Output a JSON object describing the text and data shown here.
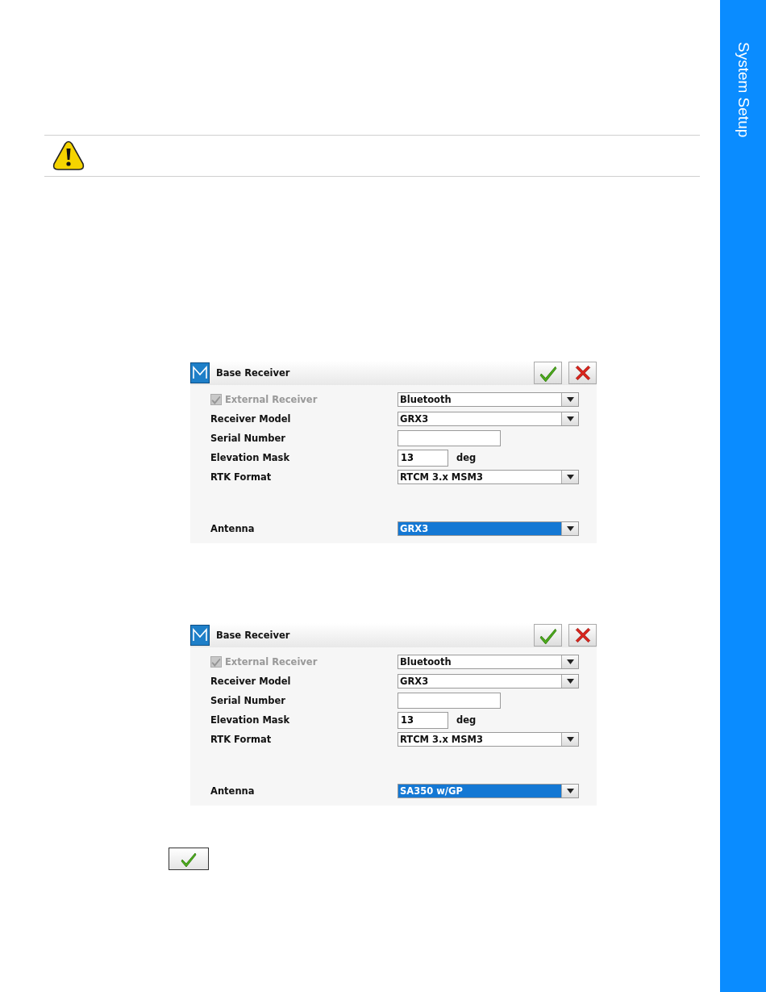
{
  "sidebar": {
    "title": "System Setup"
  },
  "dialogs": [
    {
      "title": "Base Receiver",
      "rows": [
        {
          "kind": "checkbox",
          "label": "External Receiver",
          "checked": true,
          "disabled": true,
          "control": {
            "kind": "dropdown",
            "value": "Bluetooth",
            "highlighted": false
          }
        },
        {
          "kind": "label",
          "label": "Receiver Model",
          "control": {
            "kind": "dropdown",
            "value": "GRX3",
            "highlighted": false
          }
        },
        {
          "kind": "label",
          "label": "Serial Number",
          "control": {
            "kind": "text"
          }
        },
        {
          "kind": "label",
          "label": "Elevation Mask",
          "control": {
            "kind": "number",
            "value": "13",
            "unit": "deg"
          }
        },
        {
          "kind": "label",
          "label": "RTK Format",
          "control": {
            "kind": "dropdown",
            "value": "RTCM 3.x MSM3",
            "highlighted": false
          }
        },
        {
          "kind": "label",
          "label": "Antenna",
          "control": {
            "kind": "dropdown",
            "value": "GRX3",
            "highlighted": true
          }
        }
      ]
    },
    {
      "title": "Base Receiver",
      "rows": [
        {
          "kind": "checkbox",
          "label": "External Receiver",
          "checked": true,
          "disabled": true,
          "control": {
            "kind": "dropdown",
            "value": "Bluetooth",
            "highlighted": false
          }
        },
        {
          "kind": "label",
          "label": "Receiver Model",
          "control": {
            "kind": "dropdown",
            "value": "GRX3",
            "highlighted": false
          }
        },
        {
          "kind": "label",
          "label": "Serial Number",
          "control": {
            "kind": "text"
          }
        },
        {
          "kind": "label",
          "label": "Elevation Mask",
          "control": {
            "kind": "number",
            "value": "13",
            "unit": "deg"
          }
        },
        {
          "kind": "label",
          "label": "RTK Format",
          "control": {
            "kind": "dropdown",
            "value": "RTCM 3.x MSM3",
            "highlighted": false
          }
        },
        {
          "kind": "label",
          "label": "Antenna",
          "control": {
            "kind": "dropdown",
            "value": "SA350 w/GP",
            "highlighted": true
          }
        }
      ]
    }
  ]
}
